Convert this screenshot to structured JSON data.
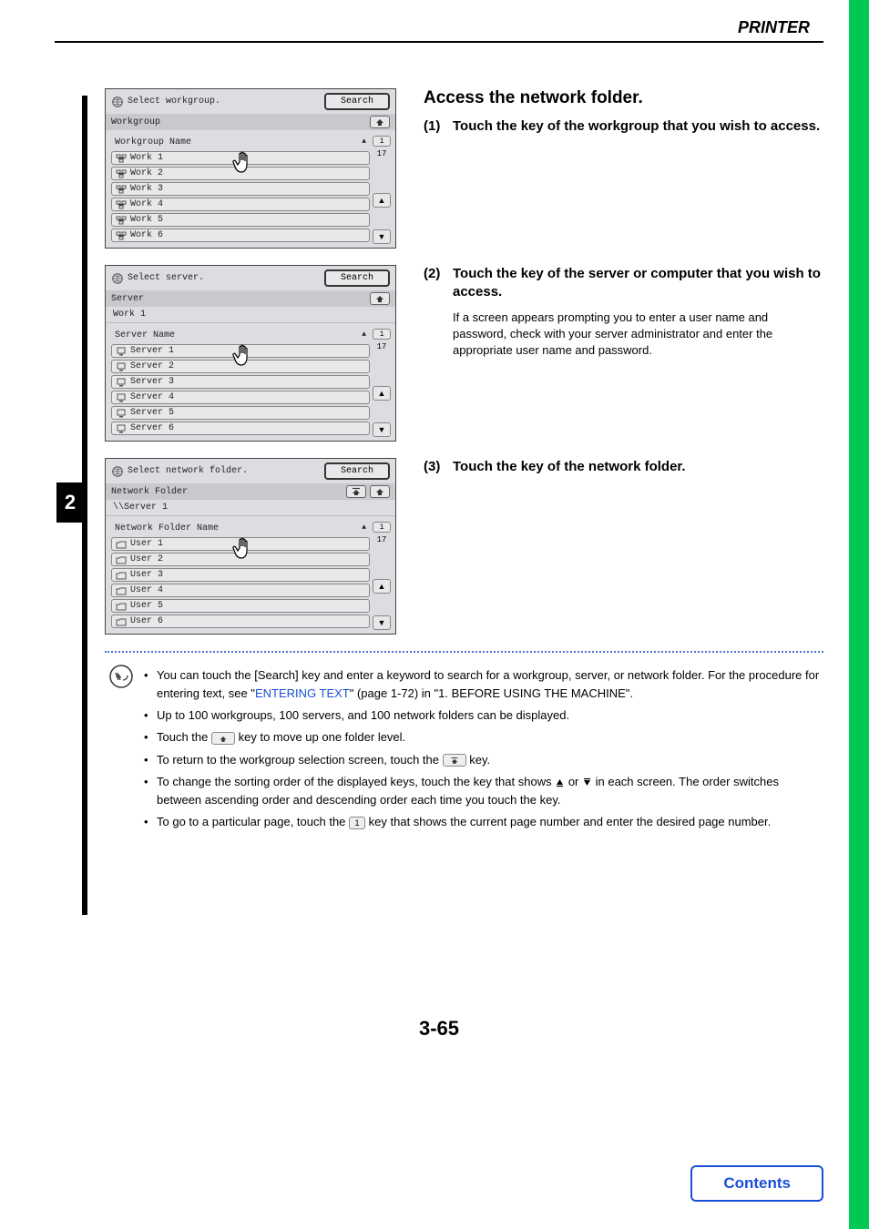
{
  "header": {
    "title": "PRINTER"
  },
  "step_tab": "2",
  "page_number": "3-65",
  "contents_btn": "Contents",
  "screens": [
    {
      "title": "Select workgroup.",
      "search": "Search",
      "sub": "Workgroup",
      "breadcrumb": null,
      "header_col": "Workgroup Name",
      "page_current": "1",
      "page_total": "17",
      "items": [
        "Work 1",
        "Work 2",
        "Work 3",
        "Work 4",
        "Work 5",
        "Work 6"
      ],
      "icon_type": "workgroup",
      "up_double": false
    },
    {
      "title": "Select server.",
      "search": "Search",
      "sub": "Server",
      "breadcrumb": "Work 1",
      "header_col": "Server Name",
      "page_current": "1",
      "page_total": "17",
      "items": [
        "Server 1",
        "Server 2",
        "Server 3",
        "Server 4",
        "Server 5",
        "Server 6"
      ],
      "icon_type": "server",
      "up_double": false
    },
    {
      "title": "Select network folder.",
      "search": "Search",
      "sub": "Network Folder",
      "breadcrumb": "\\\\Server 1",
      "header_col": "Network Folder Name",
      "page_current": "1",
      "page_total": "17",
      "items": [
        "User 1",
        "User 2",
        "User 3",
        "User 4",
        "User 5",
        "User 6"
      ],
      "icon_type": "folder",
      "up_double": true
    }
  ],
  "instructions": {
    "main_title": "Access the network folder.",
    "steps": [
      {
        "num": "(1)",
        "text": "Touch the key of the workgroup that you wish to access.",
        "desc": null
      },
      {
        "num": "(2)",
        "text": "Touch the key of the server or computer that you wish to access.",
        "desc": "If a screen appears prompting you to enter a user name and password, check with your server administrator and enter the appropriate user name and password."
      },
      {
        "num": "(3)",
        "text": "Touch the key of the network folder.",
        "desc": null
      }
    ]
  },
  "notes": {
    "n1a": "You can touch the [Search] key and enter a keyword to search for a workgroup, server, or network folder. For the procedure for entering text, see \"",
    "n1link": "ENTERING TEXT",
    "n1b": "\" (page 1-72) in \"1. BEFORE USING THE MACHINE\".",
    "n2": "Up to 100 workgroups, 100 servers, and 100 network folders can be displayed.",
    "n3a": "Touch the ",
    "n3b": " key to move up one folder level.",
    "n4a": "To return to the workgroup selection screen, touch the ",
    "n4b": " key.",
    "n5a": "To change the sorting order of the displayed keys, touch the key that shows ",
    "n5b": " or ",
    "n5c": " in each screen. The order switches between ascending order and descending order each time you touch the key.",
    "n6a": "To go to a particular page, touch the ",
    "n6b": " key that shows the current page number and enter the desired page number."
  }
}
